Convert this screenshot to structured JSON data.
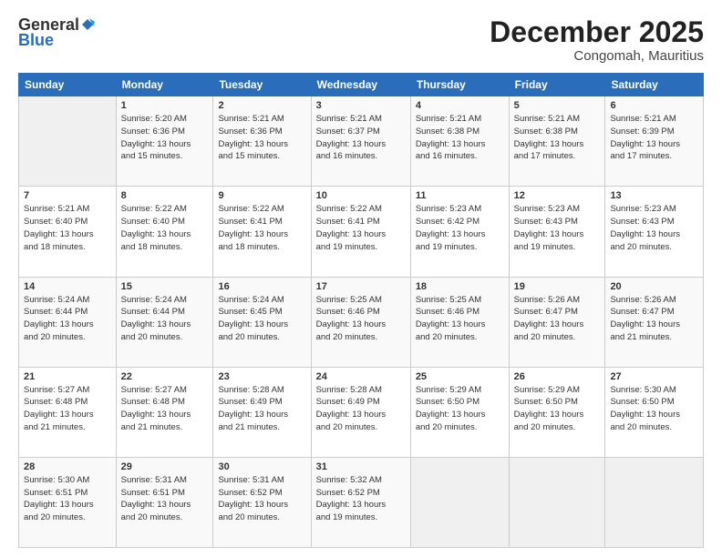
{
  "header": {
    "logo_general": "General",
    "logo_blue": "Blue",
    "month_title": "December 2025",
    "location": "Congomah, Mauritius"
  },
  "weekdays": [
    "Sunday",
    "Monday",
    "Tuesday",
    "Wednesday",
    "Thursday",
    "Friday",
    "Saturday"
  ],
  "rows": [
    [
      {
        "day": "",
        "info": ""
      },
      {
        "day": "1",
        "info": "Sunrise: 5:20 AM\nSunset: 6:36 PM\nDaylight: 13 hours\nand 15 minutes."
      },
      {
        "day": "2",
        "info": "Sunrise: 5:21 AM\nSunset: 6:36 PM\nDaylight: 13 hours\nand 15 minutes."
      },
      {
        "day": "3",
        "info": "Sunrise: 5:21 AM\nSunset: 6:37 PM\nDaylight: 13 hours\nand 16 minutes."
      },
      {
        "day": "4",
        "info": "Sunrise: 5:21 AM\nSunset: 6:38 PM\nDaylight: 13 hours\nand 16 minutes."
      },
      {
        "day": "5",
        "info": "Sunrise: 5:21 AM\nSunset: 6:38 PM\nDaylight: 13 hours\nand 17 minutes."
      },
      {
        "day": "6",
        "info": "Sunrise: 5:21 AM\nSunset: 6:39 PM\nDaylight: 13 hours\nand 17 minutes."
      }
    ],
    [
      {
        "day": "7",
        "info": "Sunrise: 5:21 AM\nSunset: 6:40 PM\nDaylight: 13 hours\nand 18 minutes."
      },
      {
        "day": "8",
        "info": "Sunrise: 5:22 AM\nSunset: 6:40 PM\nDaylight: 13 hours\nand 18 minutes."
      },
      {
        "day": "9",
        "info": "Sunrise: 5:22 AM\nSunset: 6:41 PM\nDaylight: 13 hours\nand 18 minutes."
      },
      {
        "day": "10",
        "info": "Sunrise: 5:22 AM\nSunset: 6:41 PM\nDaylight: 13 hours\nand 19 minutes."
      },
      {
        "day": "11",
        "info": "Sunrise: 5:23 AM\nSunset: 6:42 PM\nDaylight: 13 hours\nand 19 minutes."
      },
      {
        "day": "12",
        "info": "Sunrise: 5:23 AM\nSunset: 6:43 PM\nDaylight: 13 hours\nand 19 minutes."
      },
      {
        "day": "13",
        "info": "Sunrise: 5:23 AM\nSunset: 6:43 PM\nDaylight: 13 hours\nand 20 minutes."
      }
    ],
    [
      {
        "day": "14",
        "info": "Sunrise: 5:24 AM\nSunset: 6:44 PM\nDaylight: 13 hours\nand 20 minutes."
      },
      {
        "day": "15",
        "info": "Sunrise: 5:24 AM\nSunset: 6:44 PM\nDaylight: 13 hours\nand 20 minutes."
      },
      {
        "day": "16",
        "info": "Sunrise: 5:24 AM\nSunset: 6:45 PM\nDaylight: 13 hours\nand 20 minutes."
      },
      {
        "day": "17",
        "info": "Sunrise: 5:25 AM\nSunset: 6:46 PM\nDaylight: 13 hours\nand 20 minutes."
      },
      {
        "day": "18",
        "info": "Sunrise: 5:25 AM\nSunset: 6:46 PM\nDaylight: 13 hours\nand 20 minutes."
      },
      {
        "day": "19",
        "info": "Sunrise: 5:26 AM\nSunset: 6:47 PM\nDaylight: 13 hours\nand 20 minutes."
      },
      {
        "day": "20",
        "info": "Sunrise: 5:26 AM\nSunset: 6:47 PM\nDaylight: 13 hours\nand 21 minutes."
      }
    ],
    [
      {
        "day": "21",
        "info": "Sunrise: 5:27 AM\nSunset: 6:48 PM\nDaylight: 13 hours\nand 21 minutes."
      },
      {
        "day": "22",
        "info": "Sunrise: 5:27 AM\nSunset: 6:48 PM\nDaylight: 13 hours\nand 21 minutes."
      },
      {
        "day": "23",
        "info": "Sunrise: 5:28 AM\nSunset: 6:49 PM\nDaylight: 13 hours\nand 21 minutes."
      },
      {
        "day": "24",
        "info": "Sunrise: 5:28 AM\nSunset: 6:49 PM\nDaylight: 13 hours\nand 20 minutes."
      },
      {
        "day": "25",
        "info": "Sunrise: 5:29 AM\nSunset: 6:50 PM\nDaylight: 13 hours\nand 20 minutes."
      },
      {
        "day": "26",
        "info": "Sunrise: 5:29 AM\nSunset: 6:50 PM\nDaylight: 13 hours\nand 20 minutes."
      },
      {
        "day": "27",
        "info": "Sunrise: 5:30 AM\nSunset: 6:50 PM\nDaylight: 13 hours\nand 20 minutes."
      }
    ],
    [
      {
        "day": "28",
        "info": "Sunrise: 5:30 AM\nSunset: 6:51 PM\nDaylight: 13 hours\nand 20 minutes."
      },
      {
        "day": "29",
        "info": "Sunrise: 5:31 AM\nSunset: 6:51 PM\nDaylight: 13 hours\nand 20 minutes."
      },
      {
        "day": "30",
        "info": "Sunrise: 5:31 AM\nSunset: 6:52 PM\nDaylight: 13 hours\nand 20 minutes."
      },
      {
        "day": "31",
        "info": "Sunrise: 5:32 AM\nSunset: 6:52 PM\nDaylight: 13 hours\nand 19 minutes."
      },
      {
        "day": "",
        "info": ""
      },
      {
        "day": "",
        "info": ""
      },
      {
        "day": "",
        "info": ""
      }
    ]
  ]
}
